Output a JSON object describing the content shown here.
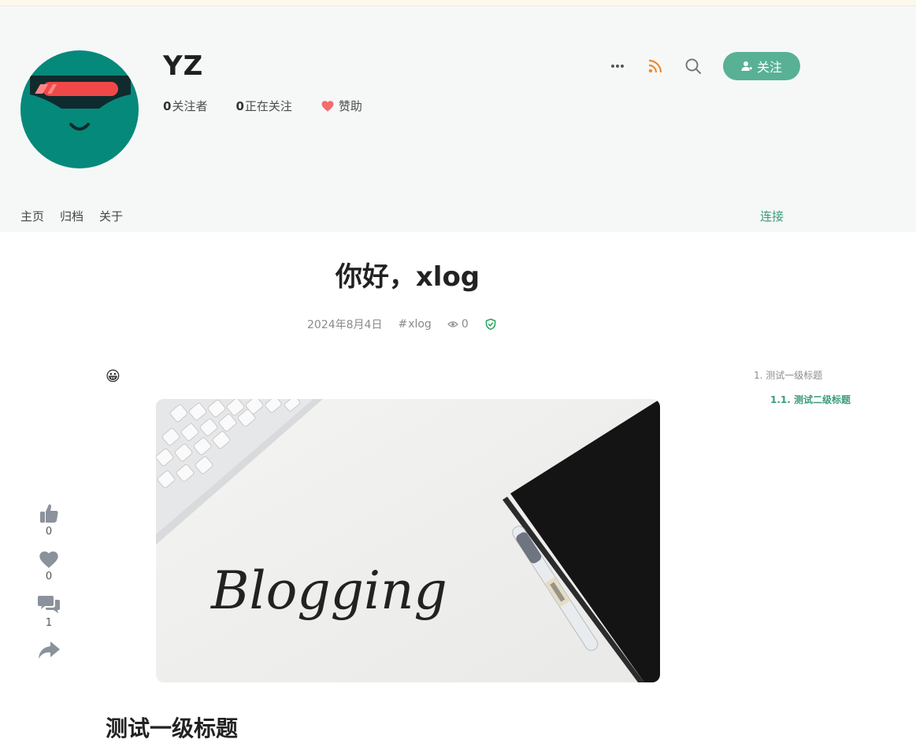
{
  "header": {
    "title": "YZ",
    "stats": {
      "followers_count": "0",
      "followers_label": "关注者",
      "following_count": "0",
      "following_label": "正在关注",
      "sponsor_label": "赞助"
    },
    "follow_label": "关注"
  },
  "nav": {
    "items": [
      "主页",
      "归档",
      "关于"
    ],
    "connect_label": "连接"
  },
  "post": {
    "title": "你好，xlog",
    "date": "2024年8月4日",
    "tag": "xlog",
    "views": "0",
    "emoji": "😀",
    "image_text": "Blogging",
    "heading1": "测试一级标题"
  },
  "toc": {
    "items": [
      {
        "label": "1. 测试一级标题"
      },
      {
        "label": "1.1. 测试二级标题"
      }
    ]
  },
  "sidebar": {
    "likes": "0",
    "collects": "0",
    "comments": "1"
  },
  "colors": {
    "accent": "#58b195",
    "header_bg": "#f6f8f8",
    "avatar_bg": "#05897b",
    "rss": "#f08a2c",
    "heart": "#f26d6d",
    "verified": "#22a35a"
  }
}
